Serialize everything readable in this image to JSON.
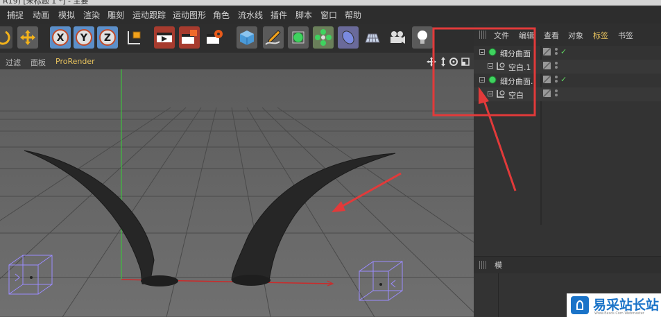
{
  "window": {
    "title": "R19)   [未标题 1 *] - 主要"
  },
  "menu": [
    "捕捉",
    "动画",
    "模拟",
    "渲染",
    "雕刻",
    "运动跟踪",
    "运动图形",
    "角色",
    "流水线",
    "插件",
    "脚本",
    "窗口",
    "帮助"
  ],
  "toolbar": {
    "axis_x": "X",
    "axis_y": "Y",
    "axis_z": "Z",
    "tools": [
      "rotate-icon",
      "move-icon",
      "x-axis-icon",
      "y-axis-icon",
      "z-axis-icon",
      "coordinate-system-icon",
      "render-view-icon",
      "render-picture-viewer-icon",
      "render-settings-icon",
      "cube-icon",
      "pen-icon",
      "subdivision-icon",
      "array-icon",
      "deformer-icon",
      "floor-icon",
      "camera-icon",
      "light-icon"
    ]
  },
  "viewport": {
    "menus": [
      "过滤",
      "面板",
      "ProRender"
    ],
    "colors": {
      "grid": "#4d4d4d",
      "bg": "#6e6e6e",
      "y_axis": "#3fbf3f",
      "x_axis": "#cc2a2a",
      "horn": "#262626",
      "null_cube": "#9b8cff",
      "arrow": "#e23a3a"
    }
  },
  "object_manager": {
    "tabs": [
      "文件",
      "编辑",
      "查看",
      "对象",
      "标签",
      "书签"
    ],
    "active_tab": "标签",
    "objects": [
      {
        "label": "细分曲面",
        "icon": "subdivision-green-icon",
        "level": 0,
        "check": "✓"
      },
      {
        "label": "空白.1",
        "icon": "null-icon",
        "level": 1,
        "check": ""
      },
      {
        "label": "细分曲面.",
        "icon": "subdivision-green-icon",
        "level": 0,
        "check": "✓"
      },
      {
        "label": "空白",
        "icon": "null-icon",
        "level": 1,
        "check": ""
      }
    ]
  },
  "attribute_manager": {
    "mode_label": "模"
  },
  "watermark": {
    "text": "易采站长站",
    "sub": "Www.Easck.Com  Webmaster"
  }
}
